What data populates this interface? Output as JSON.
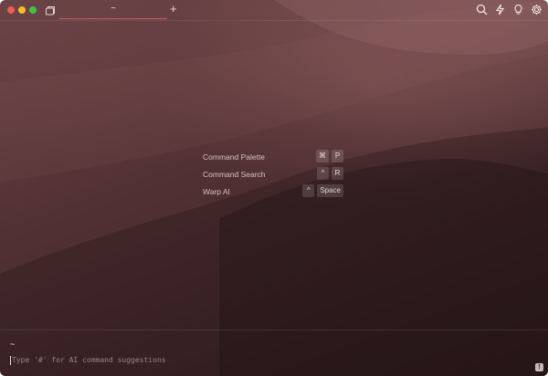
{
  "tab": {
    "title": "~",
    "new_tab_glyph": "+"
  },
  "toolbar": {
    "icons": [
      "search-icon",
      "bolt-icon",
      "lightbulb-icon",
      "gear-icon"
    ]
  },
  "shortcuts": [
    {
      "label": "Command Palette",
      "keys": [
        "⌘",
        "P"
      ]
    },
    {
      "label": "Command Search",
      "keys": [
        "^",
        "R"
      ]
    },
    {
      "label": "Warp AI",
      "keys": [
        "^",
        "Space"
      ]
    }
  ],
  "prompt": {
    "directory": "~",
    "placeholder": "Type '#' for AI command suggestions"
  },
  "colors": {
    "tab_underline": "#c85a62",
    "background": "#4a2c2f"
  }
}
